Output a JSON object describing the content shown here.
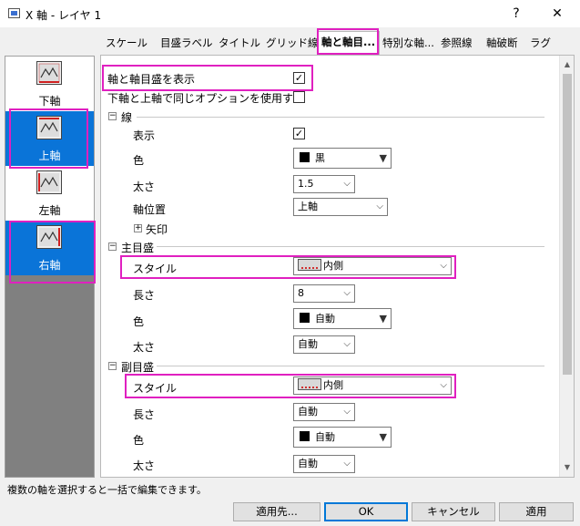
{
  "window": {
    "title": "X 軸 - レイヤ 1",
    "help_glyph": "?",
    "close_glyph": "✕"
  },
  "sidebar": {
    "items": [
      {
        "label": "下軸",
        "icon": "axis-bottom-icon"
      },
      {
        "label": "上軸",
        "icon": "axis-top-icon"
      },
      {
        "label": "左軸",
        "icon": "axis-left-icon"
      },
      {
        "label": "右軸",
        "icon": "axis-right-icon"
      }
    ]
  },
  "tabs": [
    "スケール",
    "目盛ラベル",
    "タイトル",
    "グリッド線",
    "軸と軸目...",
    "特別な軸...",
    "参照線",
    "軸破断",
    "ラグ"
  ],
  "active_tab_index": 4,
  "form": {
    "show_axis_label": "軸と軸目盛を表示",
    "show_axis_checked": "✓",
    "same_option_label": "下軸と上軸で同じオプションを使用する",
    "line_section": "線",
    "line_show_label": "表示",
    "line_show_checked": "✓",
    "line_color_label": "色",
    "line_color_value": "黒",
    "line_thickness_label": "太さ",
    "line_thickness_value": "1.5",
    "axis_position_label": "軸位置",
    "axis_position_value": "上軸",
    "arrow_label": "矢印",
    "major_section": "主目盛",
    "major_style_label": "スタイル",
    "major_style_value": "内側",
    "major_length_label": "長さ",
    "major_length_value": "8",
    "major_color_label": "色",
    "major_color_value": "自動",
    "major_thickness_label": "太さ",
    "major_thickness_value": "自動",
    "minor_section": "副目盛",
    "minor_style_label": "スタイル",
    "minor_style_value": "内側",
    "minor_length_label": "長さ",
    "minor_length_value": "自動",
    "minor_color_label": "色",
    "minor_color_value": "自動",
    "minor_thickness_label": "太さ",
    "minor_thickness_value": "自動"
  },
  "status_text": "複数の軸を選択すると一括で編集できます。",
  "buttons": {
    "apply_to": "適用先...",
    "ok": "OK",
    "cancel": "キャンセル",
    "apply": "適用"
  },
  "colors": {
    "highlight": "#e020c0",
    "selection": "#0a74d8"
  }
}
